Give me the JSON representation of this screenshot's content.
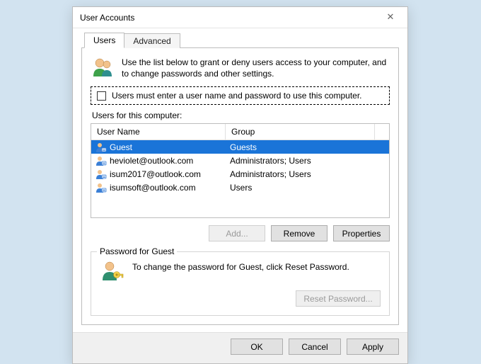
{
  "window": {
    "title": "User Accounts"
  },
  "tabs": {
    "users": "Users",
    "advanced": "Advanced"
  },
  "intro": "Use the list below to grant or deny users access to your computer, and to change passwords and other settings.",
  "checkbox_label": "Users must enter a user name and password to use this computer.",
  "users_label": "Users for this computer:",
  "columns": {
    "username": "User Name",
    "group": "Group"
  },
  "rows": [
    {
      "user": "Guest",
      "group": "Guests",
      "selected": true
    },
    {
      "user": "heviolet@outlook.com",
      "group": "Administrators; Users",
      "selected": false
    },
    {
      "user": "isum2017@outlook.com",
      "group": "Administrators; Users",
      "selected": false
    },
    {
      "user": "isumsoft@outlook.com",
      "group": "Users",
      "selected": false
    }
  ],
  "buttons": {
    "add": "Add...",
    "remove": "Remove",
    "properties": "Properties"
  },
  "password_group": {
    "legend": "Password for Guest",
    "text": "To change the password for Guest, click Reset Password.",
    "reset": "Reset Password..."
  },
  "footer": {
    "ok": "OK",
    "cancel": "Cancel",
    "apply": "Apply"
  }
}
